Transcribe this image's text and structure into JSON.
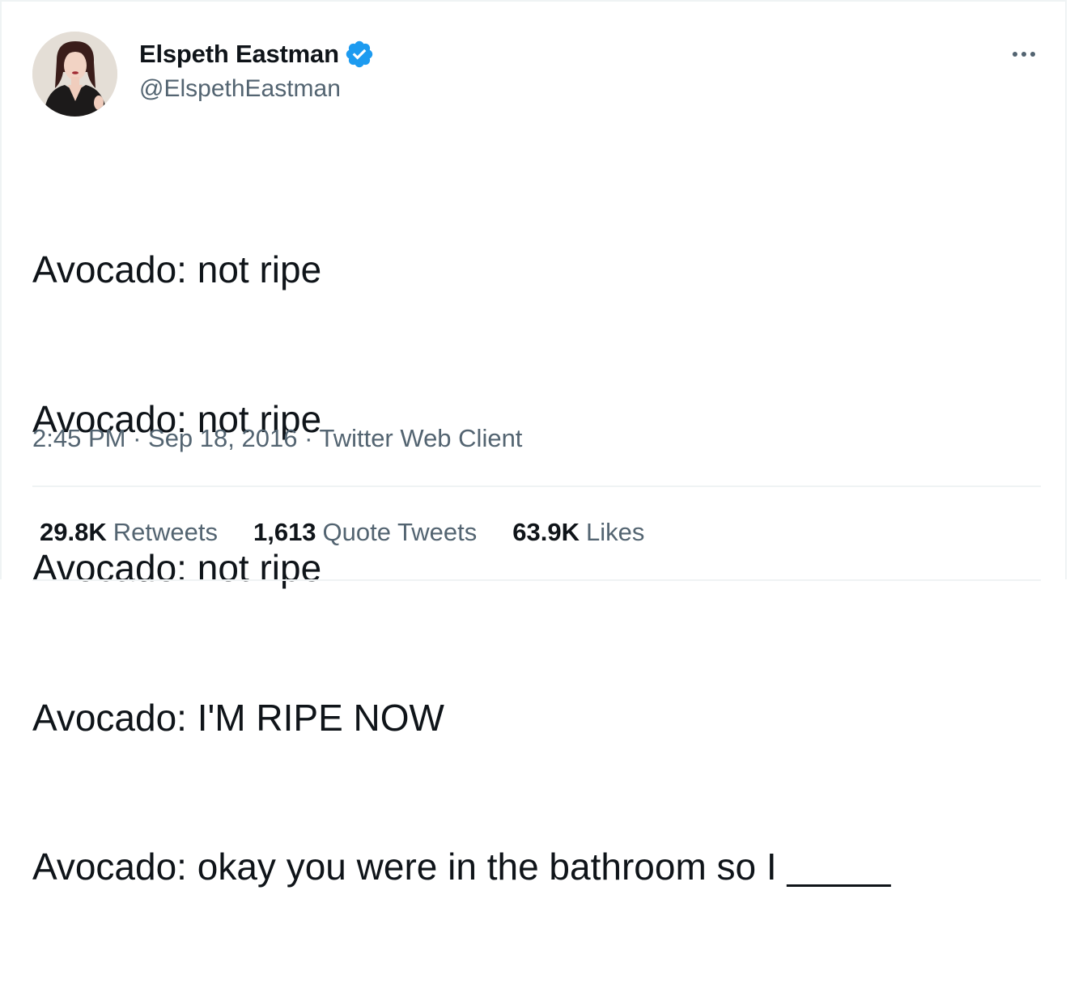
{
  "author": {
    "display_name": "Elspeth Eastman",
    "handle": "@ElspethEastman",
    "verified": true
  },
  "tweet": {
    "lines": [
      "Avocado: not ripe",
      "Avocado: not ripe",
      "Avocado: not ripe",
      "Avocado: I'M RIPE NOW",
      "Avocado: okay you were in the bathroom so I _____"
    ]
  },
  "meta": {
    "time": "2:45 PM",
    "sep1": " · ",
    "date": "Sep 18, 2016",
    "sep2": " · ",
    "source": "Twitter Web Client"
  },
  "stats": {
    "retweets_count": "29.8K",
    "retweets_label": "Retweets",
    "quotes_count": "1,613",
    "quotes_label": "Quote Tweets",
    "likes_count": "63.9K",
    "likes_label": "Likes"
  },
  "colors": {
    "text_primary": "#0f1419",
    "text_secondary": "#536471",
    "verified_blue": "#1d9bf0",
    "divider": "#eff3f4"
  },
  "icons": {
    "verified": "verified-badge-icon",
    "more": "more-options-icon"
  }
}
